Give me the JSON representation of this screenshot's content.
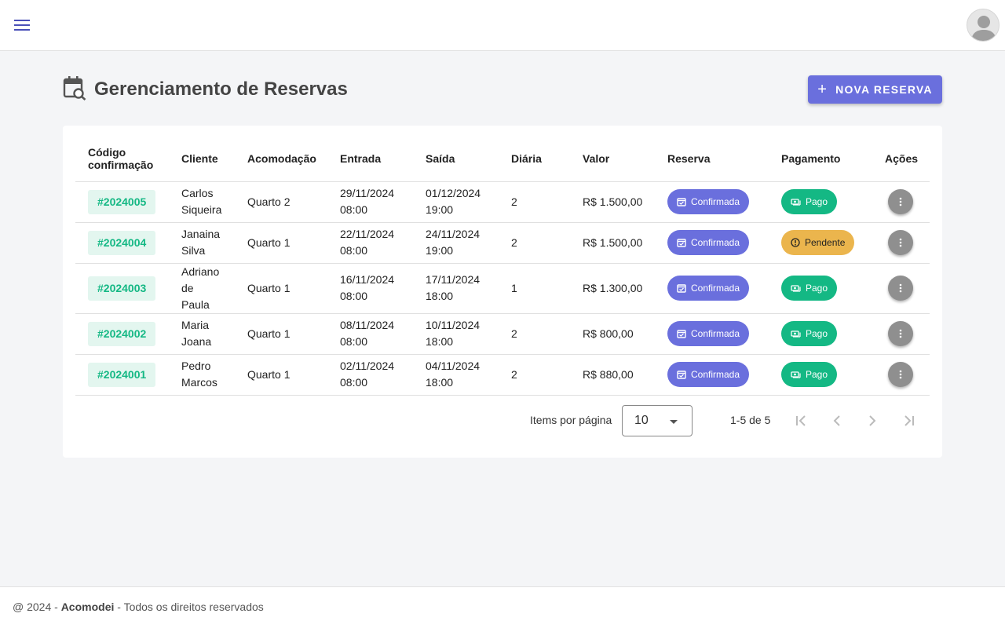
{
  "header": {
    "menu_icon": "menu-icon",
    "avatar_icon": "user-avatar-icon"
  },
  "page": {
    "title": "Gerenciamento de Reservas",
    "title_icon": "calendar-search-icon",
    "new_button_label": "NOVA RESERVA"
  },
  "table": {
    "columns": {
      "code_line1": "Código",
      "code_line2": "confirmação",
      "client": "Cliente",
      "room": "Acomodação",
      "checkin": "Entrada",
      "checkout": "Saída",
      "nights": "Diária",
      "value": "Valor",
      "booking": "Reserva",
      "payment": "Pagamento",
      "actions": "Ações"
    },
    "rows": [
      {
        "code": "#2024005",
        "client_l1": "Carlos",
        "client_l2": "Siqueira",
        "client_l3": "",
        "room": "Quarto 2",
        "in_date": "29/11/2024",
        "in_time": "08:00",
        "out_date": "01/12/2024",
        "out_time": "19:00",
        "nights": "2",
        "value": "R$ 1.500,00",
        "booking": "Confirmada",
        "payment": "Pago"
      },
      {
        "code": "#2024004",
        "client_l1": "Janaina",
        "client_l2": "Silva",
        "client_l3": "",
        "room": "Quarto 1",
        "in_date": "22/11/2024",
        "in_time": "08:00",
        "out_date": "24/11/2024",
        "out_time": "19:00",
        "nights": "2",
        "value": "R$ 1.500,00",
        "booking": "Confirmada",
        "payment": "Pendente"
      },
      {
        "code": "#2024003",
        "client_l1": "Adriano",
        "client_l2": "de",
        "client_l3": "Paula",
        "room": "Quarto 1",
        "in_date": "16/11/2024",
        "in_time": "08:00",
        "out_date": "17/11/2024",
        "out_time": "18:00",
        "nights": "1",
        "value": "R$ 1.300,00",
        "booking": "Confirmada",
        "payment": "Pago"
      },
      {
        "code": "#2024002",
        "client_l1": "Maria",
        "client_l2": "Joana",
        "client_l3": "",
        "room": "Quarto 1",
        "in_date": "08/11/2024",
        "in_time": "08:00",
        "out_date": "10/11/2024",
        "out_time": "18:00",
        "nights": "2",
        "value": "R$ 800,00",
        "booking": "Confirmada",
        "payment": "Pago"
      },
      {
        "code": "#2024001",
        "client_l1": "Pedro",
        "client_l2": "Marcos",
        "client_l3": "",
        "room": "Quarto 1",
        "in_date": "02/11/2024",
        "in_time": "08:00",
        "out_date": "04/11/2024",
        "out_time": "18:00",
        "nights": "2",
        "value": "R$ 880,00",
        "booking": "Confirmada",
        "payment": "Pago"
      }
    ]
  },
  "paginator": {
    "label": "Items por página",
    "page_size": "10",
    "range": "1-5 de 5"
  },
  "footer": {
    "prefix": "@ 2024 - ",
    "brand": "Acomodei",
    "suffix": " - Todos os direitos reservados"
  },
  "colors": {
    "primary": "#6a6fdd",
    "success": "#14b884",
    "warning": "#ebb54d",
    "action_gray": "#8f8f8f"
  }
}
